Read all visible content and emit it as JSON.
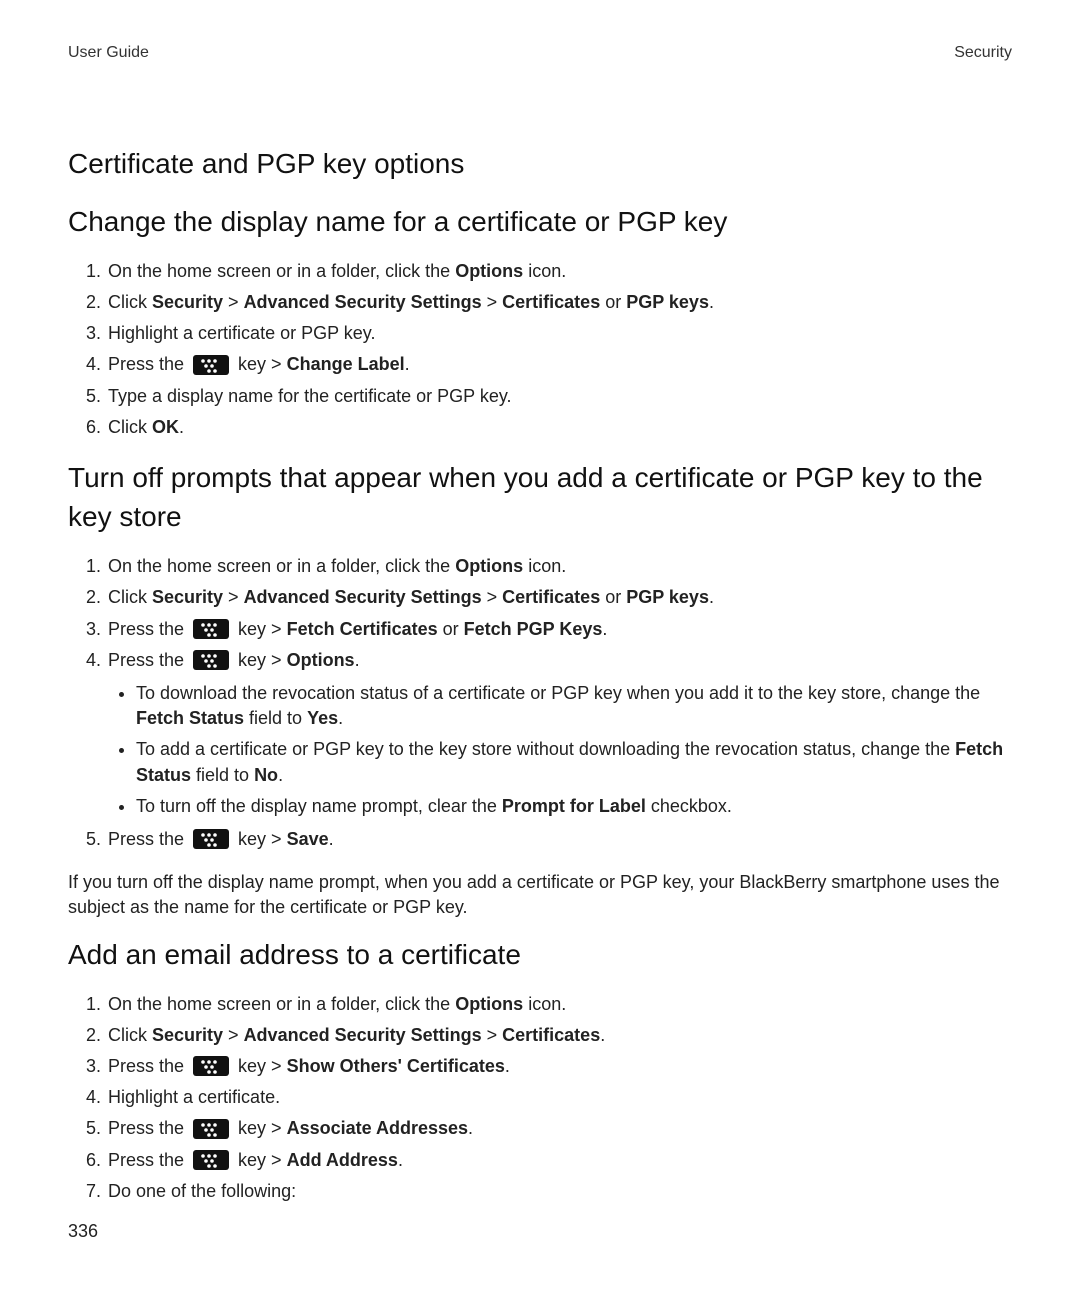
{
  "header": {
    "left": "User Guide",
    "right": "Security"
  },
  "page_number": "336",
  "sections": [
    {
      "title": "Certificate and PGP key options",
      "subtitle": "Change the display name for a certificate or PGP key",
      "steps": [
        {
          "type": "plain",
          "segments": [
            {
              "t": "On the home screen or in a folder, click the "
            },
            {
              "t": "Options",
              "b": true
            },
            {
              "t": " icon."
            }
          ]
        },
        {
          "type": "plain",
          "segments": [
            {
              "t": "Click "
            },
            {
              "t": "Security",
              "b": true
            },
            {
              "t": " > "
            },
            {
              "t": "Advanced Security Settings",
              "b": true
            },
            {
              "t": " > "
            },
            {
              "t": "Certificates",
              "b": true
            },
            {
              "t": " or "
            },
            {
              "t": "PGP keys",
              "b": true
            },
            {
              "t": "."
            }
          ]
        },
        {
          "type": "plain",
          "segments": [
            {
              "t": "Highlight a certificate or PGP key."
            }
          ]
        },
        {
          "type": "key",
          "segments_after": [
            {
              "t": "Change Label",
              "b": true
            },
            {
              "t": "."
            }
          ]
        },
        {
          "type": "plain",
          "segments": [
            {
              "t": "Type a display name for the certificate or PGP key."
            }
          ]
        },
        {
          "type": "plain",
          "segments": [
            {
              "t": "Click "
            },
            {
              "t": "OK",
              "b": true
            },
            {
              "t": "."
            }
          ]
        }
      ]
    },
    {
      "subtitle": "Turn off prompts that appear when you add a certificate or PGP key to the key store",
      "steps": [
        {
          "type": "plain",
          "segments": [
            {
              "t": "On the home screen or in a folder, click the "
            },
            {
              "t": "Options",
              "b": true
            },
            {
              "t": " icon."
            }
          ]
        },
        {
          "type": "plain",
          "segments": [
            {
              "t": "Click "
            },
            {
              "t": "Security",
              "b": true
            },
            {
              "t": " > "
            },
            {
              "t": "Advanced Security Settings",
              "b": true
            },
            {
              "t": " > "
            },
            {
              "t": "Certificates",
              "b": true
            },
            {
              "t": " or "
            },
            {
              "t": "PGP keys",
              "b": true
            },
            {
              "t": "."
            }
          ]
        },
        {
          "type": "key",
          "segments_after": [
            {
              "t": "Fetch Certificates",
              "b": true
            },
            {
              "t": " or "
            },
            {
              "t": "Fetch PGP Keys",
              "b": true
            },
            {
              "t": "."
            }
          ]
        },
        {
          "type": "key",
          "segments_after": [
            {
              "t": "Options",
              "b": true
            },
            {
              "t": "."
            }
          ],
          "bullets": [
            {
              "segments": [
                {
                  "t": "To download the revocation status of a certificate or PGP key when you add it to the key store, change the "
                },
                {
                  "t": "Fetch Status",
                  "b": true
                },
                {
                  "t": " field to "
                },
                {
                  "t": "Yes",
                  "b": true
                },
                {
                  "t": "."
                }
              ]
            },
            {
              "segments": [
                {
                  "t": "To add a certificate or PGP key to the key store without downloading the revocation status, change the "
                },
                {
                  "t": "Fetch Status",
                  "b": true
                },
                {
                  "t": " field to "
                },
                {
                  "t": "No",
                  "b": true
                },
                {
                  "t": "."
                }
              ]
            },
            {
              "segments": [
                {
                  "t": "To turn off the display name prompt, clear the "
                },
                {
                  "t": "Prompt for Label",
                  "b": true
                },
                {
                  "t": " checkbox."
                }
              ]
            }
          ]
        },
        {
          "type": "key",
          "segments_after": [
            {
              "t": "Save",
              "b": true
            },
            {
              "t": "."
            }
          ]
        }
      ],
      "note": "If you turn off the display name prompt, when you add a certificate or PGP key, your BlackBerry smartphone uses the subject as the name for the certificate or PGP key."
    },
    {
      "subtitle": "Add an email address to a certificate",
      "steps": [
        {
          "type": "plain",
          "segments": [
            {
              "t": "On the home screen or in a folder, click the "
            },
            {
              "t": "Options",
              "b": true
            },
            {
              "t": " icon."
            }
          ]
        },
        {
          "type": "plain",
          "segments": [
            {
              "t": "Click "
            },
            {
              "t": "Security",
              "b": true
            },
            {
              "t": " > "
            },
            {
              "t": "Advanced Security Settings",
              "b": true
            },
            {
              "t": " > "
            },
            {
              "t": "Certificates",
              "b": true
            },
            {
              "t": "."
            }
          ]
        },
        {
          "type": "key",
          "segments_after": [
            {
              "t": "Show Others' Certificates",
              "b": true
            },
            {
              "t": "."
            }
          ]
        },
        {
          "type": "plain",
          "segments": [
            {
              "t": "Highlight a certificate."
            }
          ]
        },
        {
          "type": "key",
          "segments_after": [
            {
              "t": "Associate Addresses",
              "b": true
            },
            {
              "t": "."
            }
          ]
        },
        {
          "type": "key",
          "segments_after": [
            {
              "t": "Add Address",
              "b": true
            },
            {
              "t": "."
            }
          ]
        },
        {
          "type": "plain",
          "segments": [
            {
              "t": "Do one of the following:"
            }
          ]
        }
      ]
    }
  ],
  "labels": {
    "press_the": "Press the",
    "key_gt": " key > "
  }
}
